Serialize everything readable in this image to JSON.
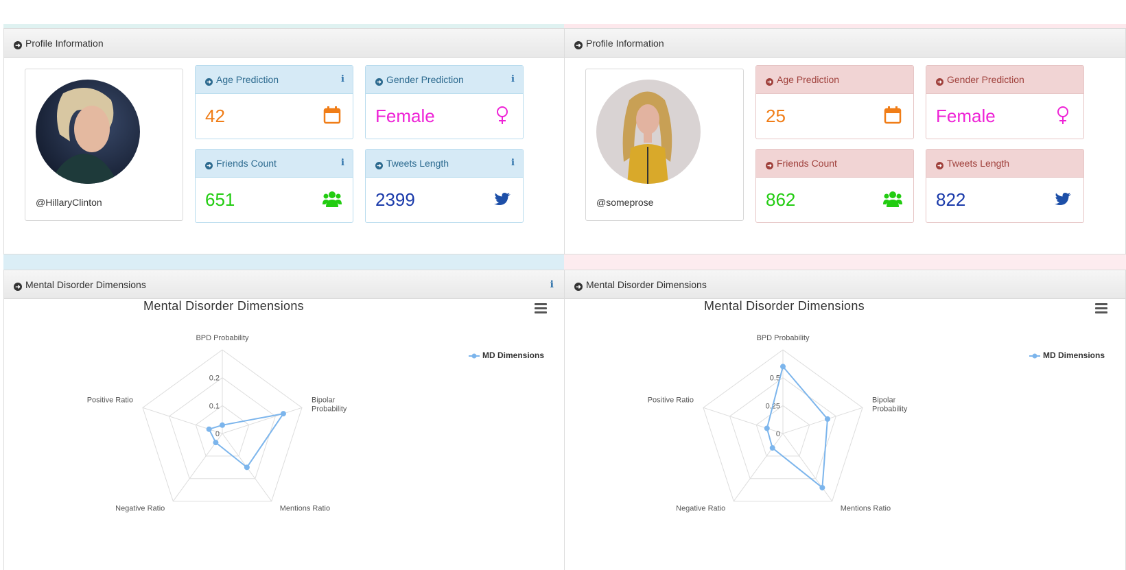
{
  "colors": {
    "age": "#f07d17",
    "gender": "#ee22d6",
    "friends": "#22cc11",
    "tweets": "#1a3aaa",
    "twitter": "#1d4fa8",
    "series": "#7cb5ec"
  },
  "profiles": [
    {
      "panel_title": "Profile Information",
      "handle": "@HillaryClinton",
      "stats": {
        "age": {
          "label": "Age Prediction",
          "value": "42",
          "icon": "calendar-icon"
        },
        "gender": {
          "label": "Gender Prediction",
          "value": "Female",
          "icon": "female-icon"
        },
        "friends": {
          "label": "Friends Count",
          "value": "651",
          "icon": "users-icon"
        },
        "tweets": {
          "label": "Tweets Length",
          "value": "2399",
          "icon": "twitter-icon"
        }
      },
      "md_panel_title": "Mental Disorder Dimensions",
      "chart_title": "Mental Disorder Dimensions",
      "legend": "MD Dimensions"
    },
    {
      "panel_title": "Profile Information",
      "handle": "@someprose",
      "stats": {
        "age": {
          "label": "Age Prediction",
          "value": "25",
          "icon": "calendar-icon"
        },
        "gender": {
          "label": "Gender Prediction",
          "value": "Female",
          "icon": "female-icon"
        },
        "friends": {
          "label": "Friends Count",
          "value": "862",
          "icon": "users-icon"
        },
        "tweets": {
          "label": "Tweets Length",
          "value": "822",
          "icon": "twitter-icon"
        }
      },
      "md_panel_title": "Mental Disorder Dimensions",
      "chart_title": "Mental Disorder Dimensions",
      "legend": "MD Dimensions"
    }
  ],
  "chart_data": [
    {
      "type": "radar",
      "title": "Mental Disorder Dimensions",
      "axes": [
        "BPD Probability",
        "Bipolar Probability",
        "Mentions Ratio",
        "Negative Ratio",
        "Positive Ratio"
      ],
      "ticks": [
        "0",
        "0.1",
        "0.2"
      ],
      "ylim": [
        0,
        0.3
      ],
      "series": [
        {
          "name": "MD Dimensions",
          "values": [
            0.03,
            0.23,
            0.15,
            0.04,
            0.05
          ]
        }
      ],
      "legend": "top-right"
    },
    {
      "type": "radar",
      "title": "Mental Disorder Dimensions",
      "axes": [
        "BPD Probability",
        "Bipolar Probability",
        "Mentions Ratio",
        "Negative Ratio",
        "Positive Ratio"
      ],
      "ticks": [
        "0",
        "0.25",
        "0.5"
      ],
      "ylim": [
        0,
        0.75
      ],
      "series": [
        {
          "name": "MD Dimensions",
          "values": [
            0.6,
            0.42,
            0.6,
            0.16,
            0.15
          ]
        }
      ],
      "legend": "top-right"
    }
  ]
}
